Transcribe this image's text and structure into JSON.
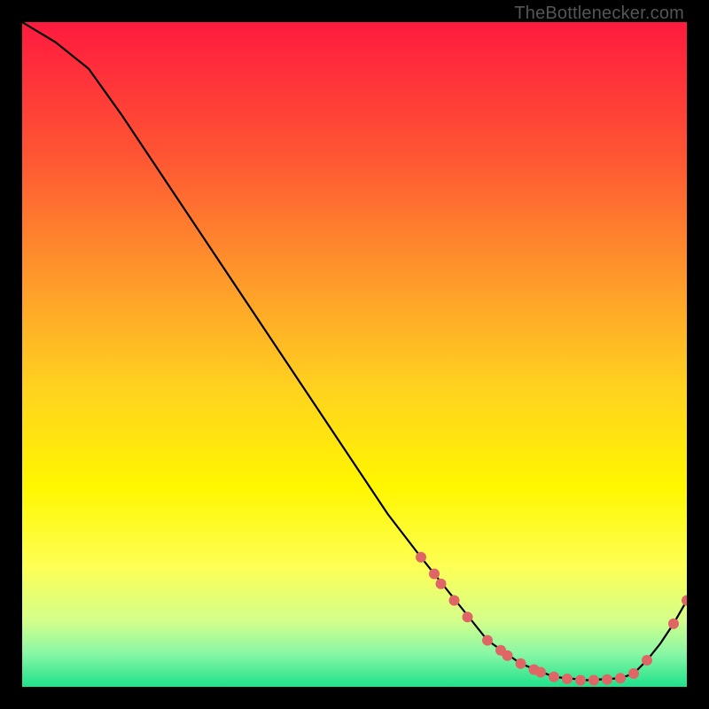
{
  "watermark": "TheBottlenecker.com",
  "chart_data": {
    "type": "line",
    "title": "",
    "xlabel": "",
    "ylabel": "",
    "xlim": [
      0,
      100
    ],
    "ylim": [
      0,
      100
    ],
    "grid": false,
    "series": [
      {
        "name": "curve",
        "color": "#000000",
        "x": [
          0,
          5,
          10,
          15,
          20,
          25,
          30,
          35,
          40,
          45,
          50,
          55,
          60,
          62,
          64,
          66,
          68,
          70,
          75,
          80,
          85,
          90,
          92,
          94,
          96,
          98,
          100
        ],
        "y": [
          100,
          97,
          93,
          86,
          78.5,
          71,
          63.5,
          56,
          48.5,
          41,
          33.5,
          26,
          19.5,
          17,
          14.5,
          12,
          9.5,
          7,
          3.5,
          1.5,
          1,
          1.3,
          2,
          4,
          6.5,
          9.5,
          13
        ]
      }
    ],
    "markers": {
      "name": "highlight-points",
      "color": "#e06666",
      "radius_px": 6,
      "x": [
        60,
        62,
        63,
        65,
        67,
        70,
        72,
        73,
        75,
        77,
        78,
        80,
        82,
        84,
        86,
        88,
        90,
        92,
        94,
        98,
        100
      ],
      "y": [
        19.5,
        17,
        15.5,
        13,
        10.5,
        7,
        5.5,
        4.7,
        3.5,
        2.6,
        2.2,
        1.5,
        1.2,
        1,
        1,
        1.1,
        1.3,
        2,
        4,
        9.5,
        13
      ]
    },
    "background_gradient": {
      "stops": [
        {
          "offset": 0.0,
          "color": "#ff1a3f"
        },
        {
          "offset": 0.2,
          "color": "#ff5533"
        },
        {
          "offset": 0.4,
          "color": "#ff9e2a"
        },
        {
          "offset": 0.55,
          "color": "#ffd21f"
        },
        {
          "offset": 0.7,
          "color": "#fff700"
        },
        {
          "offset": 0.82,
          "color": "#fdff55"
        },
        {
          "offset": 0.9,
          "color": "#d4ff8a"
        },
        {
          "offset": 0.95,
          "color": "#88f7a6"
        },
        {
          "offset": 1.0,
          "color": "#1ee18a"
        }
      ]
    }
  }
}
